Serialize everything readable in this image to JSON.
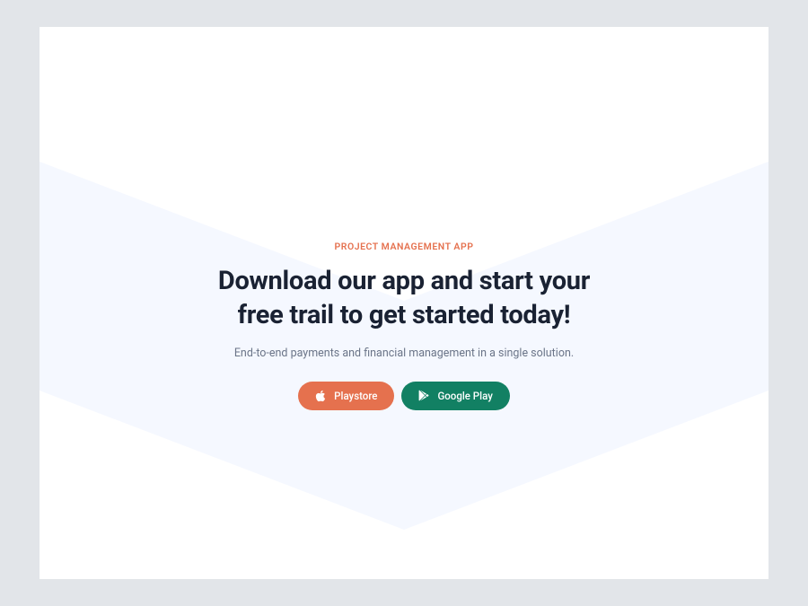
{
  "hero": {
    "eyebrow": "PROJECT MANAGEMENT APP",
    "heading": "Download our app and start your free trail to get started today!",
    "subtext": "End-to-end payments and financial management in a single solution.",
    "buttons": {
      "playstore": {
        "label": "Playstore",
        "icon": "apple-icon"
      },
      "googleplay": {
        "label": "Google Play",
        "icon": "google-play-icon"
      }
    }
  },
  "colors": {
    "page_bg": "#e2e5e9",
    "card_bg": "#ffffff",
    "chevron_bg": "#f5f8ff",
    "accent": "#e5714e",
    "secondary": "#128063",
    "heading": "#1a2233",
    "body": "#6b7588"
  }
}
